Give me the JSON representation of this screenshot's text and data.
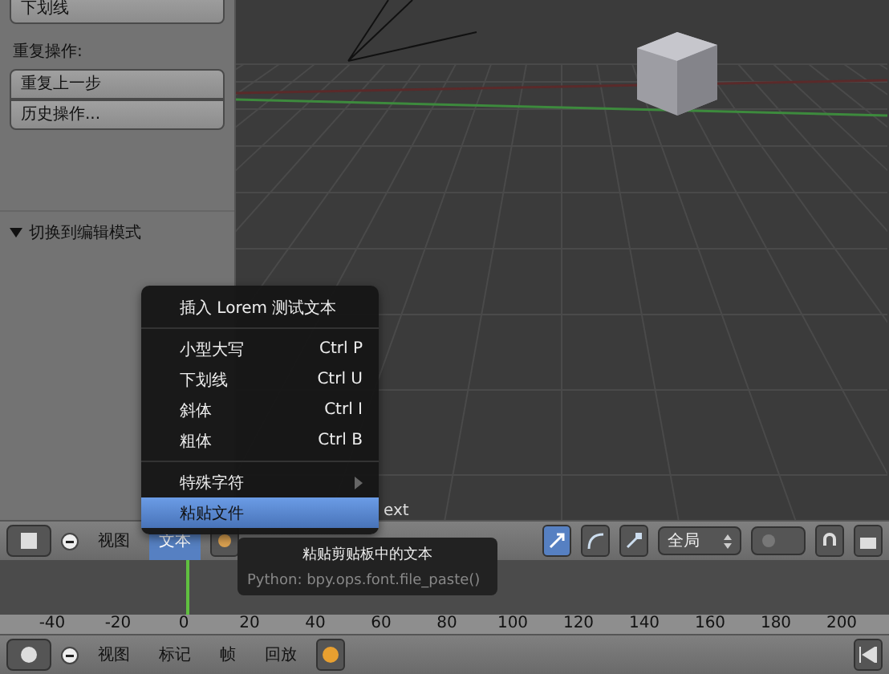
{
  "left_panel": {
    "top_button": "下划线",
    "repeat_label": "重复操作:",
    "repeat_buttons": [
      "重复上一步",
      "历史操作..."
    ],
    "section": {
      "title": "切换到编辑模式",
      "expanded": true
    }
  },
  "viewport": {
    "object_name": "ext"
  },
  "header": {
    "menus": [
      {
        "label": "视图",
        "selected": false
      },
      {
        "label": "文本",
        "selected": true
      }
    ],
    "orientation": "全局"
  },
  "menu": {
    "items": [
      {
        "kind": "action",
        "label": "插入 Lorem 测试文本",
        "selected": false
      },
      {
        "kind": "separator"
      },
      {
        "kind": "action",
        "label": "小型大写",
        "shortcut": "Ctrl P",
        "selected": false
      },
      {
        "kind": "action",
        "label": "下划线",
        "shortcut": "Ctrl U",
        "selected": false
      },
      {
        "kind": "action",
        "label": "斜体",
        "shortcut": "Ctrl I",
        "selected": false
      },
      {
        "kind": "action",
        "label": "粗体",
        "shortcut": "Ctrl B",
        "selected": false
      },
      {
        "kind": "separator"
      },
      {
        "kind": "submenu",
        "label": "特殊字符",
        "selected": false
      },
      {
        "kind": "action",
        "label": "粘贴文件",
        "selected": true
      }
    ]
  },
  "tooltip": {
    "title": "粘贴剪贴板中的文本",
    "python": "Python: bpy.ops.font.file_paste()"
  },
  "timeline": {
    "ticks": [
      "-40",
      "-20",
      "0",
      "20",
      "40",
      "60",
      "80",
      "100",
      "120",
      "140",
      "160",
      "180",
      "200"
    ]
  },
  "bottom_header": {
    "menus": [
      "视图",
      "标记",
      "帧",
      "回放"
    ]
  }
}
